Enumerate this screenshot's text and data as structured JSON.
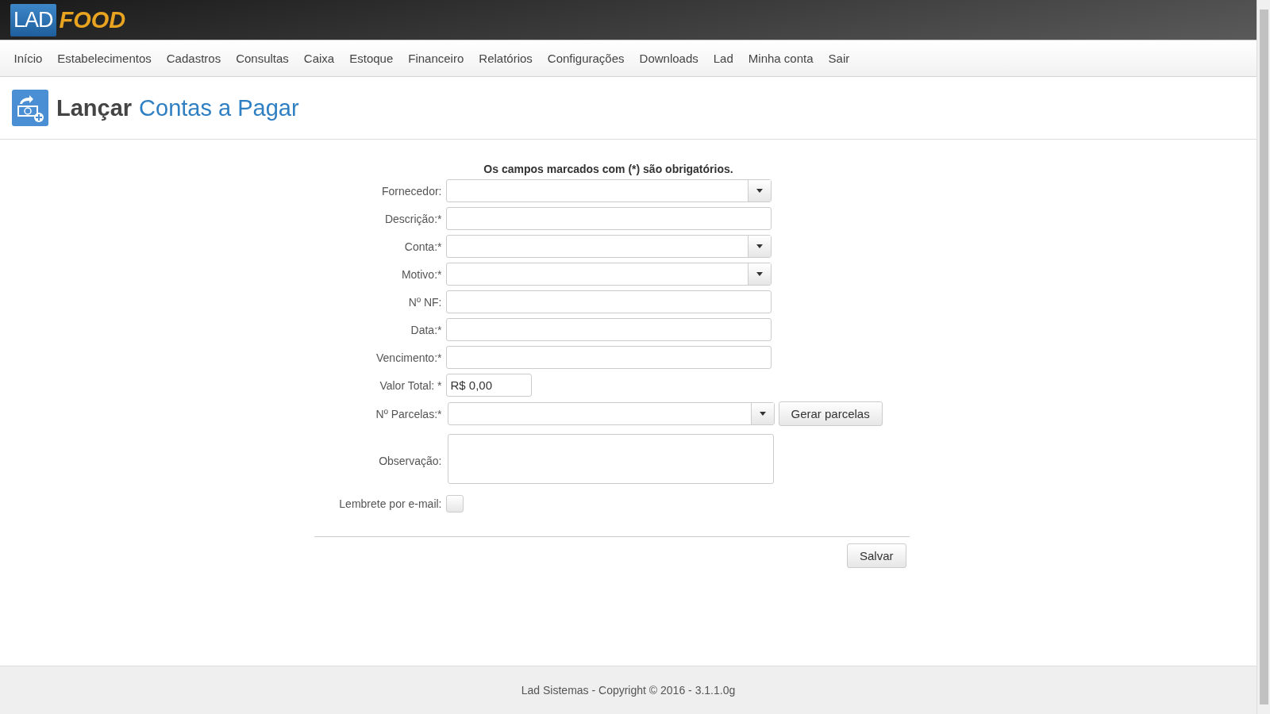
{
  "logo": {
    "left": "LAD",
    "right": "FOOD"
  },
  "nav": [
    "Início",
    "Estabelecimentos",
    "Cadastros",
    "Consultas",
    "Caixa",
    "Estoque",
    "Financeiro",
    "Relatórios",
    "Configurações",
    "Downloads",
    "Lad",
    "Minha conta",
    "Sair"
  ],
  "page_title": {
    "verb": "Lançar",
    "object": "Contas a Pagar"
  },
  "form": {
    "notice": "Os campos marcados com (*) são obrigatórios.",
    "fields": [
      {
        "kind": "select",
        "label": "Fornecedor:"
      },
      {
        "kind": "text",
        "label": "Descrição:*"
      },
      {
        "kind": "select",
        "label": "Conta:*"
      },
      {
        "kind": "select",
        "label": "Motivo:*"
      },
      {
        "kind": "text",
        "label": "Nº NF:"
      },
      {
        "kind": "text",
        "label": "Data:*"
      },
      {
        "kind": "text",
        "label": "Vencimento:*"
      },
      {
        "kind": "money",
        "label": "Valor Total: *",
        "value": "R$ 0,00"
      },
      {
        "kind": "select-button",
        "label": "Nº Parcelas:*",
        "button": "Gerar parcelas"
      },
      {
        "kind": "textarea",
        "label": "Observação:"
      },
      {
        "kind": "checkbox",
        "label": "Lembrete por e-mail:",
        "checked": false
      }
    ],
    "submit": "Salvar"
  },
  "footer": "Lad Sistemas - Copyright © 2016 - 3.1.1.0g"
}
